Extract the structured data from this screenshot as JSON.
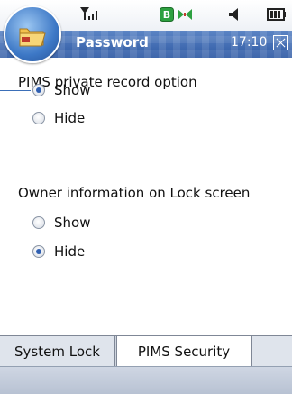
{
  "title": "Password",
  "status": {
    "time": "17:10",
    "icons": [
      "signal-icon",
      "bluetooth-icon",
      "sync-icon",
      "speaker-icon",
      "battery-icon"
    ]
  },
  "sections": [
    {
      "label": "PIMS private record option",
      "options": [
        {
          "label": "Show",
          "selected": true
        },
        {
          "label": "Hide",
          "selected": false
        }
      ]
    },
    {
      "label": "Owner information on Lock screen",
      "options": [
        {
          "label": "Show",
          "selected": false
        },
        {
          "label": "Hide",
          "selected": true
        }
      ]
    }
  ],
  "tabs": [
    {
      "label": "System Lock",
      "active": false
    },
    {
      "label": "PIMS Security",
      "active": true
    }
  ],
  "colors": {
    "titlebar": "#2f5aa4",
    "accent": "#2f5fb1"
  }
}
